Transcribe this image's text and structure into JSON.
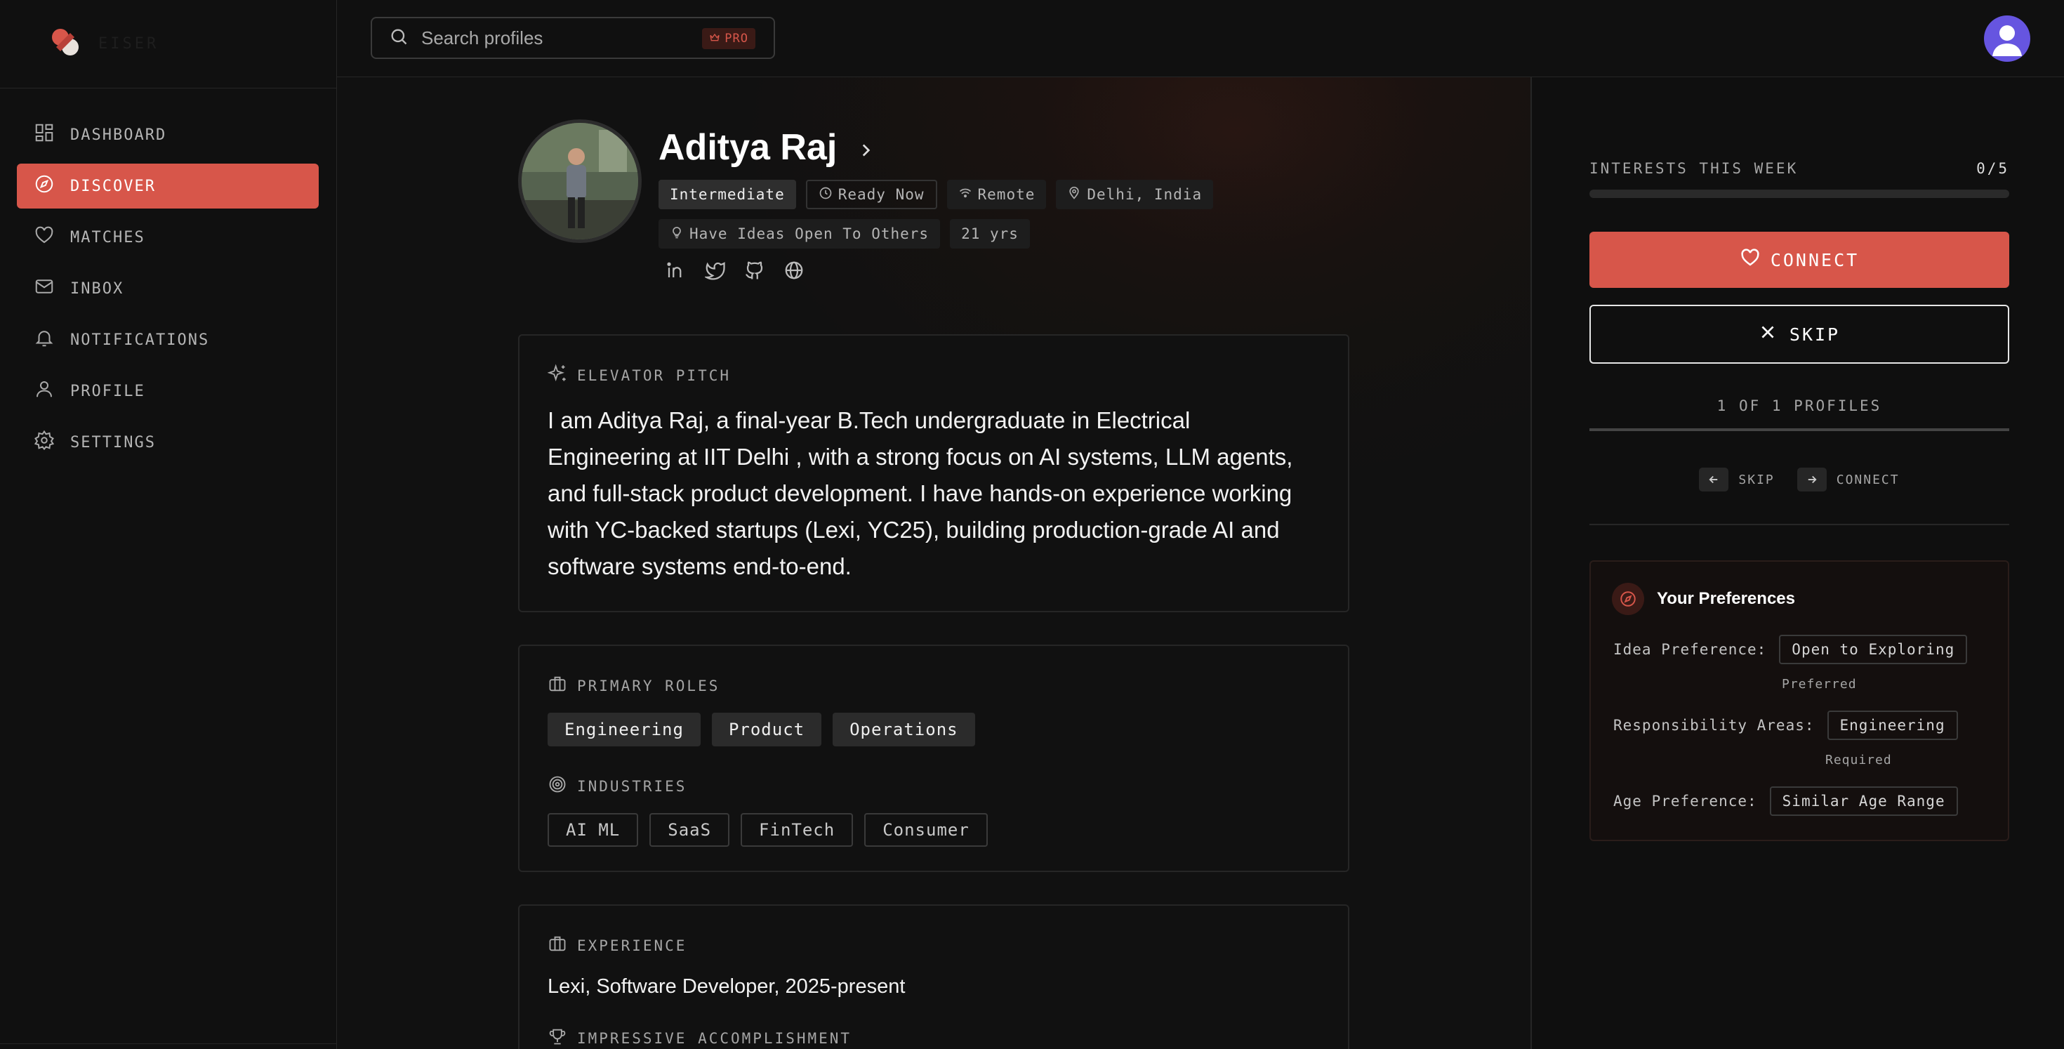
{
  "sidebar": {
    "brand": "EISER",
    "items": [
      {
        "label": "DASHBOARD",
        "icon": "dashboard-icon"
      },
      {
        "label": "DISCOVER",
        "icon": "compass-icon",
        "active": true
      },
      {
        "label": "MATCHES",
        "icon": "heart-icon"
      },
      {
        "label": "INBOX",
        "icon": "mail-icon"
      },
      {
        "label": "NOTIFICATIONS",
        "icon": "bell-icon"
      },
      {
        "label": "PROFILE",
        "icon": "user-icon"
      },
      {
        "label": "SETTINGS",
        "icon": "gear-icon"
      }
    ]
  },
  "topbar": {
    "search_placeholder": "Search profiles",
    "pro_label": "PRO"
  },
  "profile": {
    "name": "Aditya Raj",
    "tags": {
      "level": "Intermediate",
      "availability": "Ready Now",
      "work_mode": "Remote",
      "location": "Delhi, India",
      "idea_status": "Have Ideas Open To Others",
      "age": "21 yrs"
    },
    "socials": [
      "linkedin-icon",
      "twitter-icon",
      "github-icon",
      "globe-icon"
    ],
    "pitch_label": "ELEVATOR PITCH",
    "pitch": "I am Aditya Raj, a final-year B.Tech undergraduate in Electrical Engineering at IIT Delhi , with a strong focus on AI systems, LLM agents, and full-stack product development. I have hands-on experience working with YC-backed startups (Lexi, YC25), building production-grade AI and software systems end-to-end.",
    "roles_label": "PRIMARY ROLES",
    "roles": [
      "Engineering",
      "Product",
      "Operations"
    ],
    "industries_label": "INDUSTRIES",
    "industries": [
      "AI ML",
      "SaaS",
      "FinTech",
      "Consumer"
    ],
    "experience_label": "EXPERIENCE",
    "experience": "Lexi, Software Developer, 2025-present",
    "accomplishment_label": "IMPRESSIVE ACCOMPLISHMENT"
  },
  "panel": {
    "interests_label": "INTERESTS THIS WEEK",
    "interests_count": "0/5",
    "interests_progress": 0,
    "connect_label": "CONNECT",
    "skip_label": "SKIP",
    "profiles_count": "1 OF 1 PROFILES",
    "shortcut_skip": "SKIP",
    "shortcut_connect": "CONNECT",
    "prefs_title": "Your Preferences",
    "prefs": {
      "idea_label": "Idea Preference:",
      "idea_value": "Open to Exploring",
      "idea_note": "Preferred",
      "resp_label": "Responsibility Areas:",
      "resp_value": "Engineering",
      "resp_note": "Required",
      "age_label": "Age Preference:",
      "age_value": "Similar Age Range"
    }
  },
  "colors": {
    "accent": "#d7564a",
    "background": "#0f0f0f",
    "avatar": "#6655e0"
  }
}
